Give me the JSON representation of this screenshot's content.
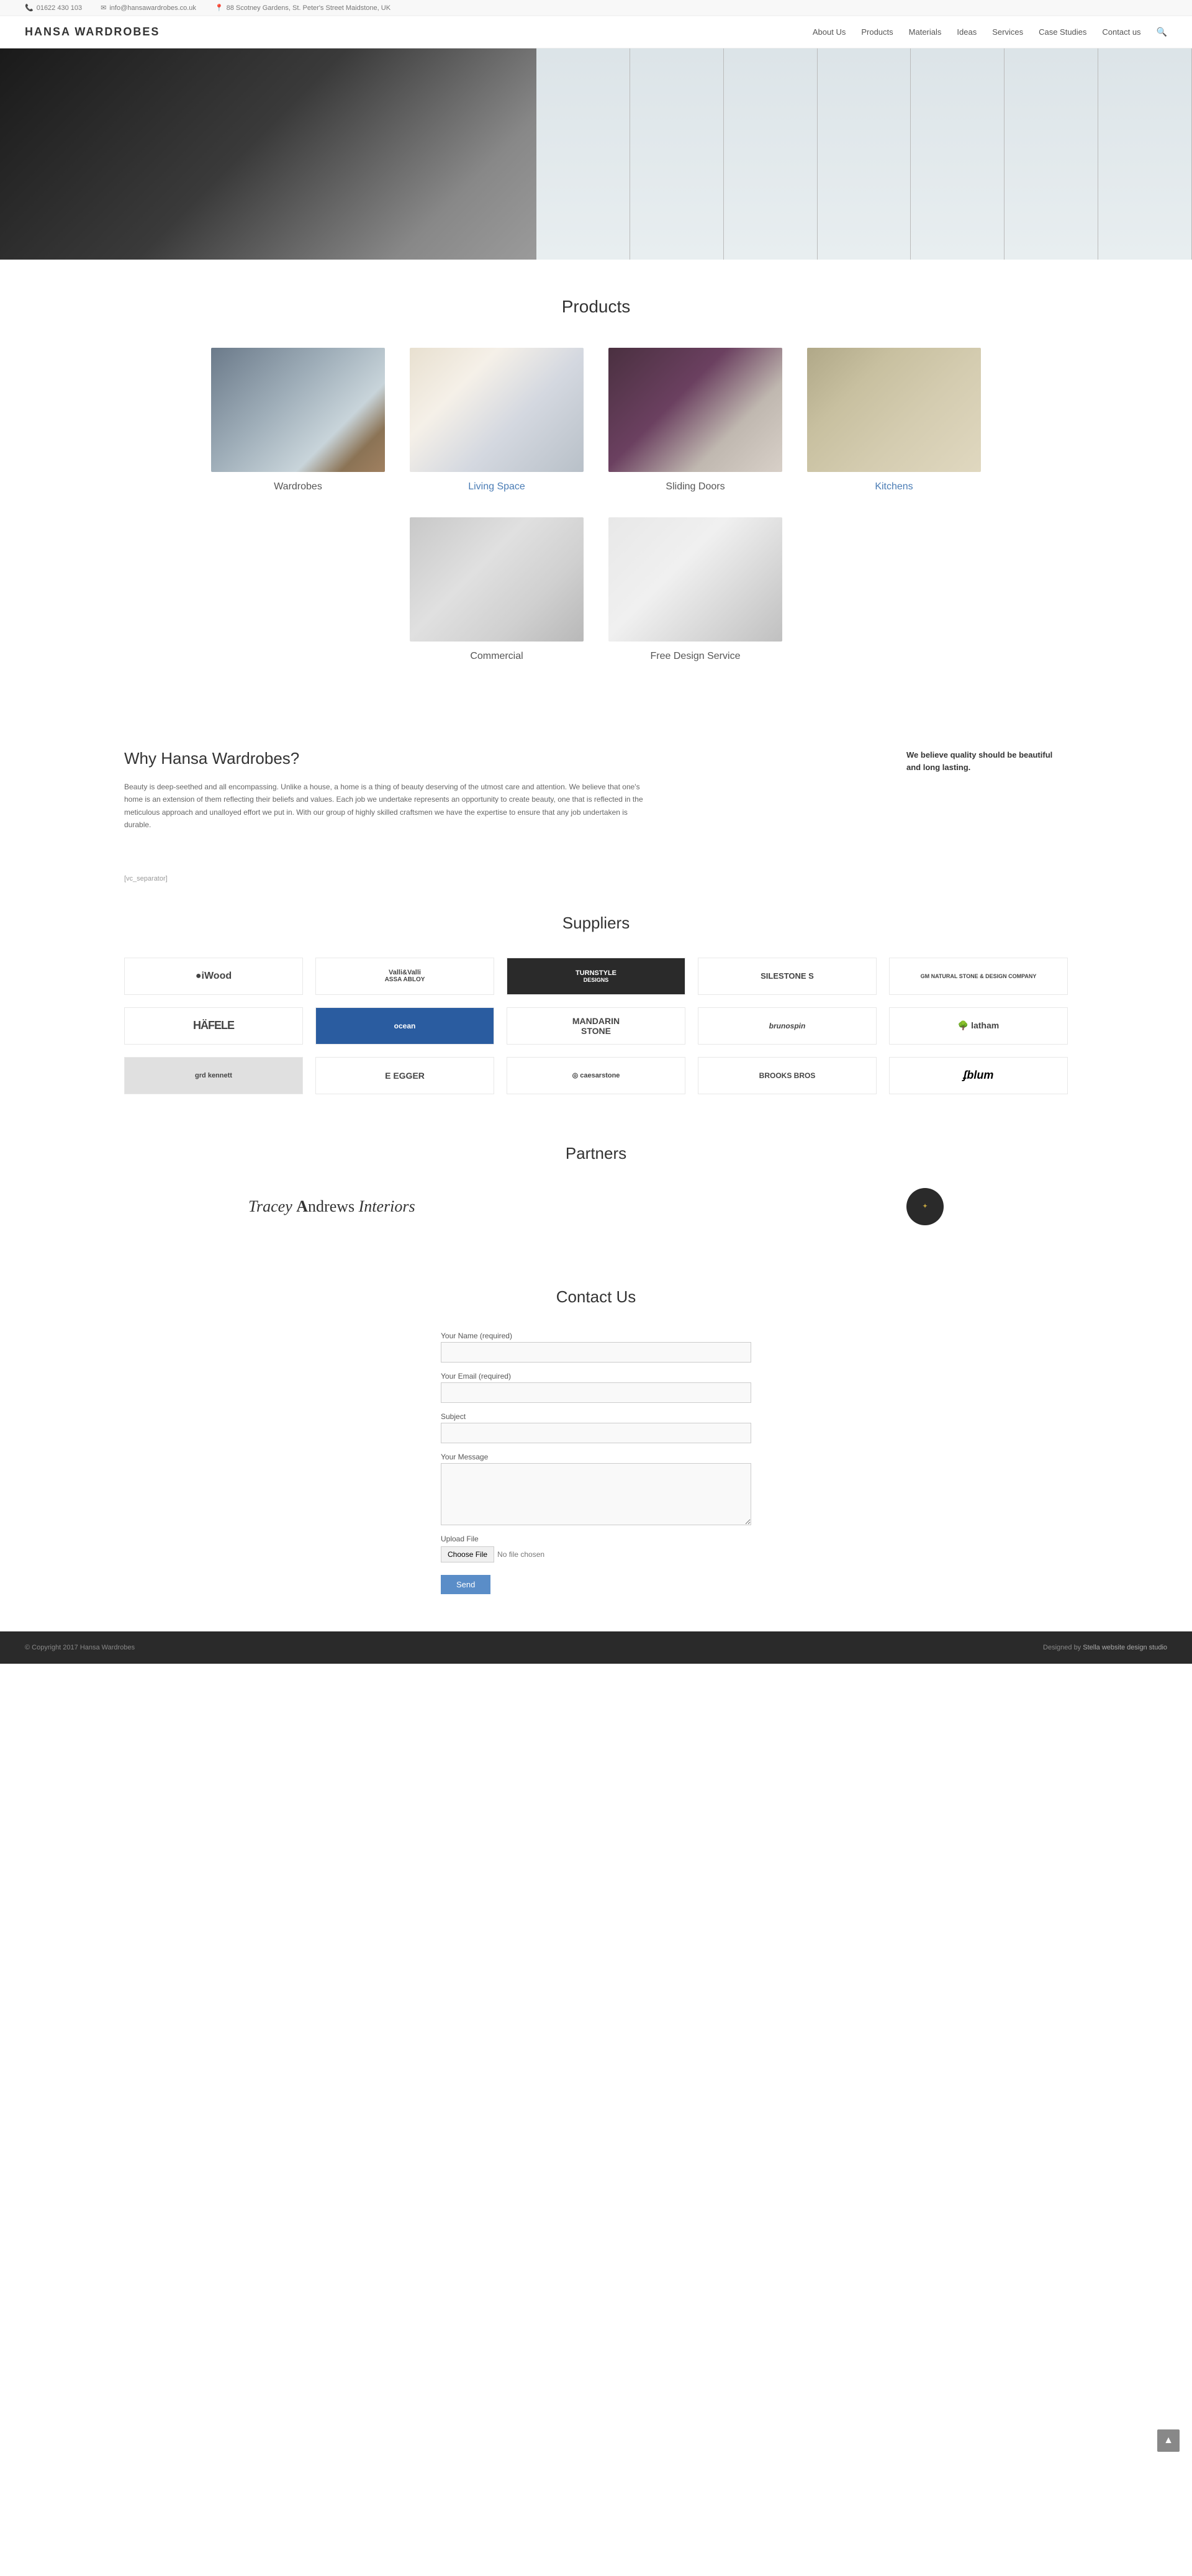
{
  "topbar": {
    "phone": "01622 430 103",
    "email": "info@hansawardrobes.co.uk",
    "address": "88 Scotney Gardens, St. Peter's Street Maidstone, UK"
  },
  "header": {
    "logo": "HANSA WARDROBES",
    "nav": [
      {
        "label": "About Us"
      },
      {
        "label": "Products"
      },
      {
        "label": "Materials"
      },
      {
        "label": "Ideas"
      },
      {
        "label": "Services"
      },
      {
        "label": "Case Studies"
      },
      {
        "label": "Contact us"
      }
    ]
  },
  "products": {
    "title": "Products",
    "items": [
      {
        "label": "Wardrobes",
        "img_class": "img-wardrobes",
        "blue": false
      },
      {
        "label": "Living Space",
        "img_class": "img-living",
        "blue": true
      },
      {
        "label": "Sliding Doors",
        "img_class": "img-sliding",
        "blue": false
      },
      {
        "label": "Kitchens",
        "img_class": "img-kitchens",
        "blue": true
      },
      {
        "label": "Commercial",
        "img_class": "img-commercial",
        "blue": false
      },
      {
        "label": "Free Design Service",
        "img_class": "img-design",
        "blue": false
      }
    ]
  },
  "why": {
    "title": "Why Hansa Wardrobes?",
    "text": "Beauty is deep-seethed and all encompassing. Unlike a house, a home is a thing of beauty deserving of the utmost care and attention. We believe that one's home is an extension of them reflecting their beliefs and values. Each job we undertake represents an opportunity to create beauty, one that is reflected in the meticulous approach and unalloyed effort we put in. With our group of highly skilled craftsmen we have the expertise to ensure that any job undertaken is durable.",
    "quote": "We believe quality should be beautiful and long lasting."
  },
  "separator": "[vc_separator]",
  "suppliers": {
    "title": "Suppliers",
    "logos": [
      {
        "label": "iWood",
        "class": "iwood"
      },
      {
        "label": "Valli & Valli\nASSA ABLOY",
        "class": "valli"
      },
      {
        "label": "TURNSTYLE\nDESIGNS",
        "class": "turnstyle"
      },
      {
        "label": "SILESTONE S",
        "class": "silestone"
      },
      {
        "label": "GM Natural Stone & Design Company",
        "class": "gm"
      },
      {
        "label": "HÄFELE",
        "class": "hafele"
      },
      {
        "label": "ocean",
        "class": "ocean"
      },
      {
        "label": "MANDARIN\nSTONE",
        "class": "mandarin"
      },
      {
        "label": "brunospin",
        "class": "brunos"
      },
      {
        "label": "latham",
        "class": "latham"
      },
      {
        "label": "grd kennett",
        "class": "gkennett"
      },
      {
        "label": "E EGGER",
        "class": "egger"
      },
      {
        "label": "@ caesarstone",
        "class": "caesarstone"
      },
      {
        "label": "BROOKS BROS",
        "class": "brooksbros"
      },
      {
        "label": "blum",
        "class": "blum"
      }
    ]
  },
  "partners": {
    "title": "Partners",
    "items": [
      {
        "label": "Tracey Andrews Interiors",
        "type": "text"
      },
      {
        "label": "TAI",
        "type": "badge"
      }
    ]
  },
  "contact": {
    "title": "Contact Us",
    "fields": {
      "name_label": "Your Name (required)",
      "email_label": "Your Email (required)",
      "subject_label": "Subject",
      "message_label": "Your Message",
      "upload_label": "Upload File",
      "choose_file_btn": "Choose File",
      "no_file_text": "No file chosen",
      "send_btn": "Send"
    }
  },
  "footer": {
    "copyright": "© Copyright 2017 Hansa Wardrobes",
    "designer_text": "Designed by",
    "designer_link": "Stella website design studio"
  }
}
